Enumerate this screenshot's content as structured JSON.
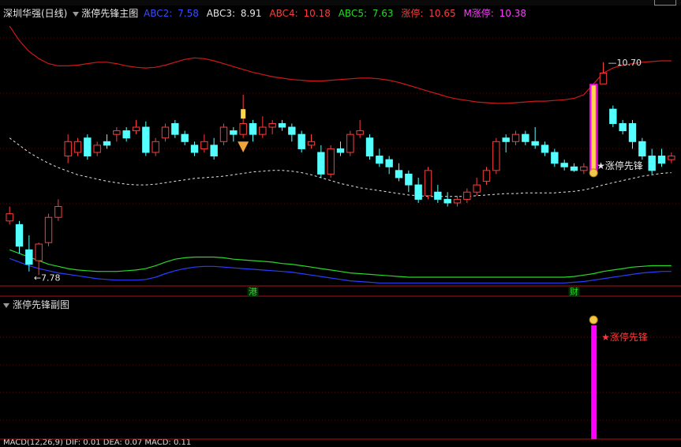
{
  "header": {
    "stock_name": "深圳华强(日线)",
    "indicator_name": "涨停先锋主图",
    "values": [
      {
        "label": "ABC2:",
        "value": "7.58",
        "color": "#3a4cff"
      },
      {
        "label": "ABC3:",
        "value": "8.91",
        "color": "#e6e6e6"
      },
      {
        "label": "ABC4:",
        "value": "10.18",
        "color": "#ff3b3b"
      },
      {
        "label": "ABC5:",
        "value": "7.63",
        "color": "#26d926"
      },
      {
        "label": "涨停:",
        "value": "10.65",
        "color": "#ff3b3b"
      },
      {
        "label": "M涨停:",
        "value": "10.38",
        "color": "#ff3cff"
      }
    ]
  },
  "sub_header": {
    "indicator_name": "涨停先锋副图"
  },
  "macd_header": "MACD(12,26,9) DIF: 0.01 DEA: 0.07 MACD: 0.11",
  "annotations": {
    "high_label": "10.70",
    "low_label": "7.78",
    "signal_text": "涨停先锋",
    "signal_text_sub": "★涨停先锋",
    "marker_gang": "港",
    "marker_cai": "财"
  },
  "colors": {
    "up": "#ff3b3b",
    "down": "#54ffff",
    "upper_band": "#d01818",
    "mid_band": "#e6e6e6",
    "green_band": "#26d926",
    "blue_band": "#2b3cff",
    "signal": "#ff00ff"
  },
  "chart_data": {
    "type": "candlestick",
    "ylim": [
      7.6,
      11.3
    ],
    "candles": [
      [
        8.5,
        8.6,
        8.7,
        8.45
      ],
      [
        8.45,
        8.15,
        8.5,
        8.05
      ],
      [
        8.1,
        7.9,
        8.3,
        7.8
      ],
      [
        7.95,
        8.18,
        8.2,
        7.75
      ],
      [
        8.2,
        8.55,
        8.6,
        8.15
      ],
      [
        8.55,
        8.7,
        8.8,
        8.5
      ],
      [
        9.4,
        9.6,
        9.7,
        9.3
      ],
      [
        9.45,
        9.6,
        9.65,
        9.4
      ],
      [
        9.65,
        9.4,
        9.7,
        9.35
      ],
      [
        9.45,
        9.55,
        9.6,
        9.4
      ],
      [
        9.6,
        9.55,
        9.7,
        9.5
      ],
      [
        9.7,
        9.75,
        9.8,
        9.6
      ],
      [
        9.75,
        9.65,
        9.8,
        9.6
      ],
      [
        9.75,
        9.8,
        9.9,
        9.7
      ],
      [
        9.8,
        9.45,
        9.88,
        9.4
      ],
      [
        9.45,
        9.6,
        9.65,
        9.4
      ],
      [
        9.65,
        9.8,
        9.85,
        9.6
      ],
      [
        9.85,
        9.7,
        9.9,
        9.65
      ],
      [
        9.7,
        9.6,
        9.75,
        9.55
      ],
      [
        9.55,
        9.45,
        9.6,
        9.4
      ],
      [
        9.5,
        9.6,
        9.7,
        9.45
      ],
      [
        9.55,
        9.4,
        9.65,
        9.35
      ],
      [
        9.6,
        9.8,
        9.85,
        9.55
      ],
      [
        9.75,
        9.7,
        9.8,
        9.6
      ],
      [
        9.7,
        9.85,
        10.25,
        9.65
      ],
      [
        9.85,
        9.7,
        9.9,
        9.6
      ],
      [
        9.7,
        9.8,
        9.95,
        9.65
      ],
      [
        9.8,
        9.85,
        9.9,
        9.7
      ],
      [
        9.85,
        9.8,
        9.9,
        9.75
      ],
      [
        9.8,
        9.7,
        9.85,
        9.6
      ],
      [
        9.7,
        9.5,
        9.75,
        9.45
      ],
      [
        9.55,
        9.6,
        9.7,
        9.5
      ],
      [
        9.45,
        9.15,
        9.55,
        9.1
      ],
      [
        9.15,
        9.5,
        9.55,
        9.1
      ],
      [
        9.5,
        9.45,
        9.6,
        9.4
      ],
      [
        9.45,
        9.7,
        9.75,
        9.4
      ],
      [
        9.7,
        9.75,
        9.9,
        9.65
      ],
      [
        9.65,
        9.4,
        9.7,
        9.35
      ],
      [
        9.4,
        9.3,
        9.5,
        9.25
      ],
      [
        9.35,
        9.25,
        9.4,
        9.15
      ],
      [
        9.2,
        9.1,
        9.3,
        9.05
      ],
      [
        9.15,
        9.0,
        9.2,
        8.9
      ],
      [
        9.0,
        8.8,
        9.1,
        8.75
      ],
      [
        8.85,
        9.2,
        9.25,
        8.8
      ],
      [
        8.9,
        8.8,
        9.0,
        8.75
      ],
      [
        8.8,
        8.75,
        8.9,
        8.7
      ],
      [
        8.75,
        8.8,
        8.85,
        8.7
      ],
      [
        8.8,
        8.9,
        8.95,
        8.75
      ],
      [
        8.9,
        9.0,
        9.1,
        8.85
      ],
      [
        9.05,
        9.2,
        9.25,
        9.0
      ],
      [
        9.2,
        9.6,
        9.65,
        9.15
      ],
      [
        9.65,
        9.6,
        9.7,
        9.45
      ],
      [
        9.6,
        9.7,
        9.75,
        9.55
      ],
      [
        9.7,
        9.6,
        9.75,
        9.55
      ],
      [
        9.6,
        9.55,
        9.8,
        9.5
      ],
      [
        9.55,
        9.45,
        9.6,
        9.4
      ],
      [
        9.45,
        9.3,
        9.5,
        9.25
      ],
      [
        9.3,
        9.25,
        9.35,
        9.2
      ],
      [
        9.25,
        9.2,
        9.3,
        9.18
      ],
      [
        9.2,
        9.25,
        9.3,
        9.15
      ],
      [
        9.25,
        9.4,
        10.4,
        9.2
      ],
      [
        10.4,
        10.55,
        10.7,
        10.4
      ],
      [
        10.05,
        9.85,
        10.1,
        9.8
      ],
      [
        9.85,
        9.75,
        9.9,
        9.7
      ],
      [
        9.85,
        9.6,
        9.9,
        9.5
      ],
      [
        9.6,
        9.4,
        9.65,
        9.35
      ],
      [
        9.4,
        9.2,
        9.5,
        9.15
      ],
      [
        9.4,
        9.3,
        9.5,
        9.25
      ],
      [
        9.35,
        9.4,
        9.45,
        9.3
      ]
    ],
    "upper_band": [
      11.2,
      11.0,
      10.85,
      10.75,
      10.68,
      10.65,
      10.65,
      10.66,
      10.68,
      10.7,
      10.7,
      10.68,
      10.65,
      10.63,
      10.62,
      10.63,
      10.66,
      10.7,
      10.74,
      10.76,
      10.75,
      10.72,
      10.68,
      10.64,
      10.6,
      10.56,
      10.53,
      10.5,
      10.48,
      10.46,
      10.45,
      10.44,
      10.44,
      10.45,
      10.46,
      10.47,
      10.48,
      10.48,
      10.47,
      10.45,
      10.42,
      10.38,
      10.34,
      10.3,
      10.26,
      10.22,
      10.19,
      10.17,
      10.15,
      10.14,
      10.13,
      10.13,
      10.14,
      10.15,
      10.16,
      10.16,
      10.17,
      10.18,
      10.2,
      10.25,
      10.4,
      10.55,
      10.62,
      10.66,
      10.68,
      10.7,
      10.71,
      10.72,
      10.72
    ],
    "mid_band": [
      9.65,
      9.55,
      9.45,
      9.37,
      9.3,
      9.24,
      9.19,
      9.14,
      9.11,
      9.08,
      9.05,
      9.03,
      9.01,
      9.0,
      9.0,
      9.01,
      9.03,
      9.05,
      9.07,
      9.09,
      9.1,
      9.11,
      9.12,
      9.14,
      9.16,
      9.18,
      9.19,
      9.2,
      9.2,
      9.19,
      9.17,
      9.14,
      9.1,
      9.06,
      9.02,
      8.99,
      8.96,
      8.94,
      8.92,
      8.9,
      8.88,
      8.86,
      8.85,
      8.84,
      8.84,
      8.84,
      8.84,
      8.84,
      8.85,
      8.86,
      8.87,
      8.88,
      8.88,
      8.89,
      8.89,
      8.89,
      8.89,
      8.9,
      8.91,
      8.93,
      8.96,
      9.0,
      9.03,
      9.06,
      9.09,
      9.12,
      9.14,
      9.16,
      9.17
    ],
    "green_band": [
      8.1,
      8.05,
      8.0,
      7.95,
      7.9,
      7.87,
      7.84,
      7.82,
      7.81,
      7.8,
      7.8,
      7.8,
      7.81,
      7.82,
      7.84,
      7.88,
      7.93,
      7.97,
      7.99,
      8.0,
      8.0,
      8.0,
      7.99,
      7.97,
      7.96,
      7.95,
      7.94,
      7.93,
      7.91,
      7.9,
      7.88,
      7.86,
      7.84,
      7.82,
      7.8,
      7.78,
      7.77,
      7.76,
      7.75,
      7.74,
      7.73,
      7.72,
      7.72,
      7.72,
      7.72,
      7.72,
      7.72,
      7.72,
      7.72,
      7.72,
      7.72,
      7.72,
      7.72,
      7.72,
      7.72,
      7.72,
      7.72,
      7.72,
      7.73,
      7.75,
      7.77,
      7.8,
      7.82,
      7.84,
      7.86,
      7.87,
      7.88,
      7.88,
      7.88
    ],
    "blue_band": [
      7.98,
      7.93,
      7.88,
      7.84,
      7.81,
      7.78,
      7.76,
      7.74,
      7.72,
      7.7,
      7.69,
      7.68,
      7.68,
      7.68,
      7.69,
      7.72,
      7.77,
      7.81,
      7.84,
      7.86,
      7.87,
      7.87,
      7.86,
      7.85,
      7.84,
      7.83,
      7.82,
      7.81,
      7.8,
      7.79,
      7.77,
      7.75,
      7.73,
      7.71,
      7.69,
      7.67,
      7.66,
      7.65,
      7.64,
      7.64,
      7.64,
      7.64,
      7.64,
      7.64,
      7.64,
      7.64,
      7.64,
      7.64,
      7.64,
      7.64,
      7.64,
      7.64,
      7.64,
      7.64,
      7.64,
      7.64,
      7.64,
      7.64,
      7.65,
      7.66,
      7.68,
      7.7,
      7.72,
      7.74,
      7.76,
      7.78,
      7.79,
      7.8,
      7.8
    ],
    "signal_index": 60,
    "high_index": 61,
    "low_index": 2
  }
}
